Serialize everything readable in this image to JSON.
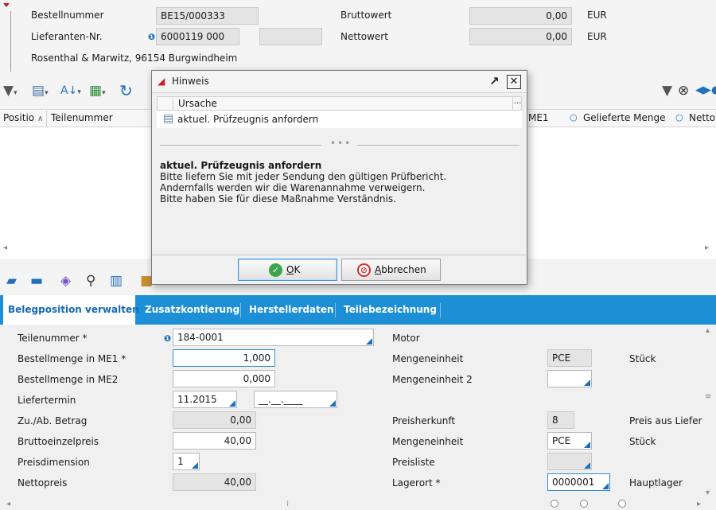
{
  "header": {
    "bestellnummer_label": "Bestellnummer",
    "bestellnummer_value": "BE15/000333",
    "lieferant_label": "Lieferanten-Nr.",
    "lieferant_value": "6000119 000",
    "supplier_address": "Rosenthal & Marwitz, 96154 Burgwindheim",
    "bruttowert_label": "Bruttowert",
    "bruttowert_value": "0,00",
    "bruttowert_currency": "EUR",
    "nettowert_label": "Nettowert",
    "nettowert_value": "0,00",
    "nettowert_currency": "EUR"
  },
  "grid": {
    "columns": [
      "Positio",
      "Teilenummer",
      "ME1",
      "Gelieferte Menge",
      "Netto"
    ]
  },
  "tabs": [
    "Belegposition verwalten",
    "Zusatzkontierung",
    "Herstellerdaten",
    "Teilebezeichnung"
  ],
  "form": {
    "left": [
      {
        "label": "Teilenummer *",
        "value": "184-0001"
      },
      {
        "label": "Bestellmenge in ME1 *",
        "value": "1,000"
      },
      {
        "label": "Bestellmenge in ME2",
        "value": "0,000"
      },
      {
        "label": "Liefertermin",
        "value": "11.2015",
        "value2": "__.__.____"
      },
      {
        "label": "Zu./Ab. Betrag",
        "value": "0,00"
      },
      {
        "label": "Bruttoeinzelpreis",
        "value": "40,00"
      },
      {
        "label": "Preisdimension",
        "value": "1"
      },
      {
        "label": "Nettopreis",
        "value": "40,00"
      }
    ],
    "right": [
      {
        "label": "Motor",
        "value": "",
        "desc": ""
      },
      {
        "label": "Mengeneinheit",
        "value": "PCE",
        "desc": "Stück"
      },
      {
        "label": "Mengeneinheit 2",
        "value": "",
        "desc": ""
      },
      {
        "label": "Preisherkunft",
        "value": "8",
        "desc": "Preis aus Liefer"
      },
      {
        "label": "Mengeneinheit",
        "value": "PCE",
        "desc": "Stück"
      },
      {
        "label": "Preisliste",
        "value": "",
        "desc": ""
      },
      {
        "label": "Lagerort *",
        "value": "0000001",
        "desc": "Hauptlager"
      }
    ]
  },
  "dialog": {
    "title": "Hinweis",
    "column_header": "Ursache",
    "row_text": "aktuel. Prüfzeugnis anfordern",
    "detail_title": "aktuel. Prüfzeugnis anfordern",
    "detail_lines": [
      "Bitte liefern Sie mit jeder Sendung den gültigen Prüfbericht.",
      "Andernfalls werden wir die Warenannahme verweigern.",
      "Bitte haben Sie für diese Maßnahme Verständnis."
    ],
    "ok_rest": "K",
    "ok_mnemonic": "O",
    "cancel_mnemonic": "A",
    "cancel_rest": "bbrechen"
  },
  "colors": {
    "accent": "#1c8fd6",
    "ok_icon": "#3aa64a",
    "cancel_icon": "#d92d2d"
  },
  "icons": [
    "filter-dropdown-icon",
    "print-icon",
    "sort-icon",
    "excel-export-icon",
    "refresh-icon",
    "filter-icon",
    "binoculars-icon",
    "nav-arrows-icon"
  ]
}
